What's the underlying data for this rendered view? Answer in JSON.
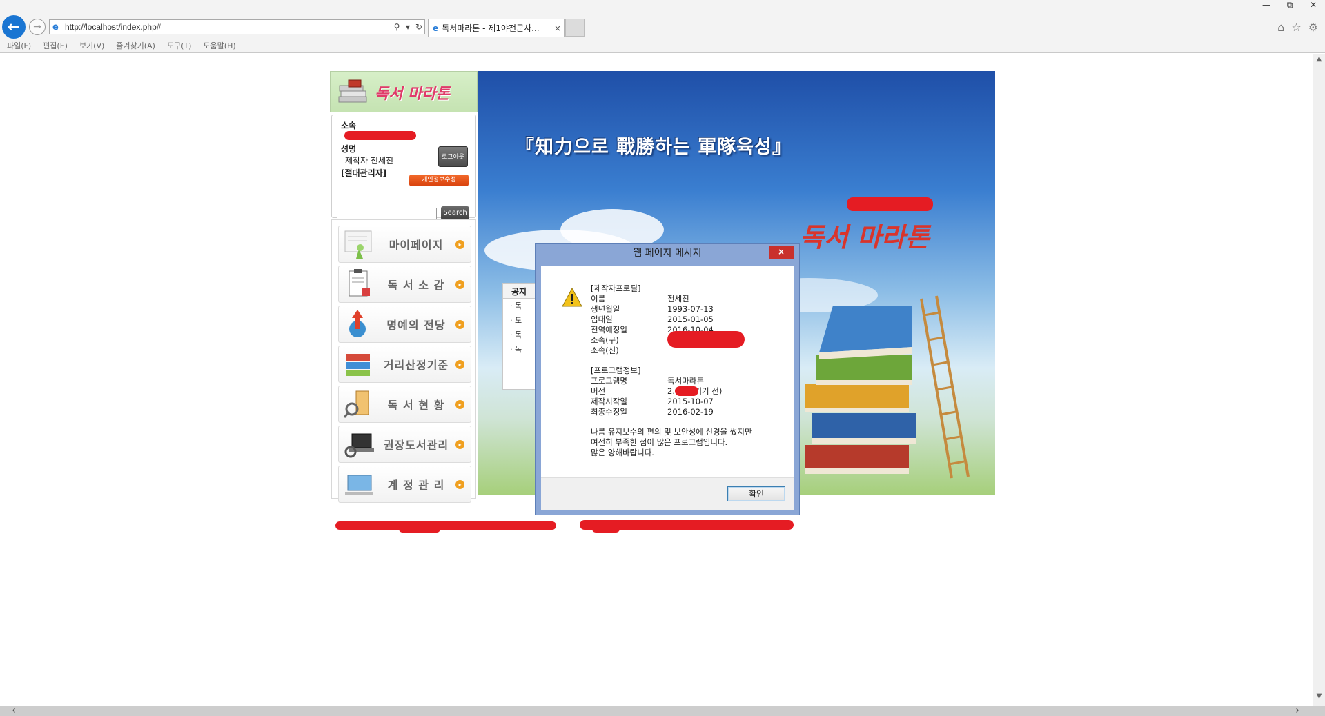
{
  "browser": {
    "url": "http://localhost/index.php#",
    "tab_title": "독서마라톤 - 제1야전군사...",
    "tab_close": "×",
    "menu": [
      "파일(F)",
      "편집(E)",
      "보기(V)",
      "즐겨찾기(A)",
      "도구(T)",
      "도움말(H)"
    ]
  },
  "sidebar": {
    "logo_text": "독서 마라톤",
    "info": {
      "affiliation_label": "소속",
      "name_label": "성명",
      "name_value": "제작자 전세진",
      "role": "[절대관리자]",
      "logout_label": "로그아웃",
      "profile_edit_label": "개인정보수정"
    },
    "search": {
      "button_label": "Search",
      "value": ""
    },
    "menu_items": [
      {
        "label": "마이페이지"
      },
      {
        "label": "독 서 소 감"
      },
      {
        "label": "명예의 전당"
      },
      {
        "label": "거리산정기준"
      },
      {
        "label": "독 서 현 황"
      },
      {
        "label": "권장도서관리"
      },
      {
        "label": "계 정 관 리"
      }
    ]
  },
  "banner": {
    "slogan": "『知力으로 戰勝하는 軍隊육성』",
    "title": "독서 마라톤",
    "notice": {
      "header": "공지",
      "rows": [
        "독",
        "도",
        "독",
        "독"
      ]
    }
  },
  "dialog": {
    "title": "웹 페이지 메시지",
    "close_label": "×",
    "section1": "[제작자프로필]",
    "profile": [
      {
        "label": "이름",
        "value": "전세진"
      },
      {
        "label": "생년월일",
        "value": "1993-07-13"
      },
      {
        "label": "입대일",
        "value": "2015-01-05"
      },
      {
        "label": "전역예정일",
        "value": "2016-10-04"
      },
      {
        "label": "소속(구)",
        "value": ""
      },
      {
        "label": "소속(신)",
        "value": ""
      }
    ],
    "section2": "[프로그램정보]",
    "program": [
      {
        "label": "프로그램명",
        "value": "독서마라톤"
      },
      {
        "label": "버전",
        "value": "2.      에 넘기기 전)"
      },
      {
        "label": "제작시작일",
        "value": "2015-10-07"
      },
      {
        "label": "최종수정일",
        "value": "2016-02-19"
      }
    ],
    "message": [
      "나름 유지보수의 편의 및 보안성에 신경을 썼지만",
      "여전히 부족한 점이 많은 프로그램입니다.",
      "많은 양해바랍니다."
    ],
    "ok_label": "확인"
  },
  "colors": {
    "accent": "#1a75d2",
    "redaction": "#e51c23",
    "dialog_frame": "#8aa6d6"
  }
}
